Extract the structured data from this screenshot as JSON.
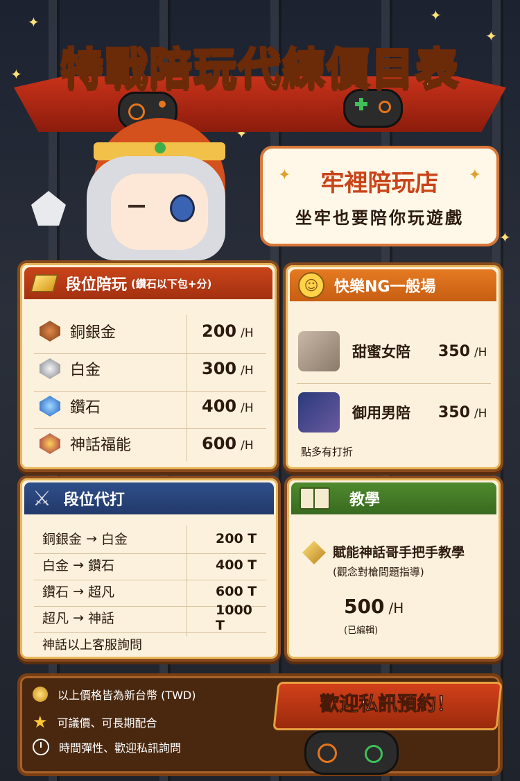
{
  "header": {
    "title": "特戰陪玩代練價目表"
  },
  "bubble": {
    "shop_name": "牢裡陪玩店",
    "tagline": "坐牢也要陪你玩遊戲"
  },
  "rank_play": {
    "title": "段位陪玩",
    "subtitle": "(鑽石以下包+分)",
    "rows": [
      {
        "name": "銅銀金",
        "price": "200",
        "unit": "/H"
      },
      {
        "name": "白金",
        "price": "300",
        "unit": "/H"
      },
      {
        "name": "鑽石",
        "price": "400",
        "unit": "/H"
      },
      {
        "name": "神話福能",
        "price": "600",
        "unit": "/H"
      }
    ]
  },
  "casual": {
    "title": "快樂NG一般場",
    "rows": [
      {
        "name": "甜蜜女陪",
        "price": "350",
        "unit": "/H"
      },
      {
        "name": "御用男陪",
        "price": "350",
        "unit": "/H"
      }
    ],
    "note": "點多有打折"
  },
  "boost": {
    "title": "段位代打",
    "rows": [
      {
        "from": "銅銀金",
        "arrow": "→",
        "to": "白金",
        "price": "200",
        "unit": "T"
      },
      {
        "from": "白金",
        "arrow": "→",
        "to": "鑽石",
        "price": "400",
        "unit": "T"
      },
      {
        "from": "鑽石",
        "arrow": "→",
        "to": "超凡",
        "price": "600",
        "unit": "T"
      },
      {
        "from": "超凡",
        "arrow": "→",
        "to": "神話",
        "price": "1000",
        "unit": "T"
      }
    ],
    "note": "神話以上客服詢問"
  },
  "teach": {
    "title": "教學",
    "item": "賦能神話哥手把手教學",
    "sub": "(觀念對槍問題指導)",
    "price": "500",
    "unit": "/H",
    "edit_note": "(已編輯)"
  },
  "footer": {
    "notes": [
      "以上價格皆為新台幣 (TWD)",
      "可議價、可長期配合",
      "時間彈性、歡迎私訊詢問"
    ],
    "cta": "歡迎私訊預約！"
  },
  "colors": {
    "accent": "#c9441a",
    "gold": "#ffd64a",
    "frame": "#8a4b1c"
  }
}
